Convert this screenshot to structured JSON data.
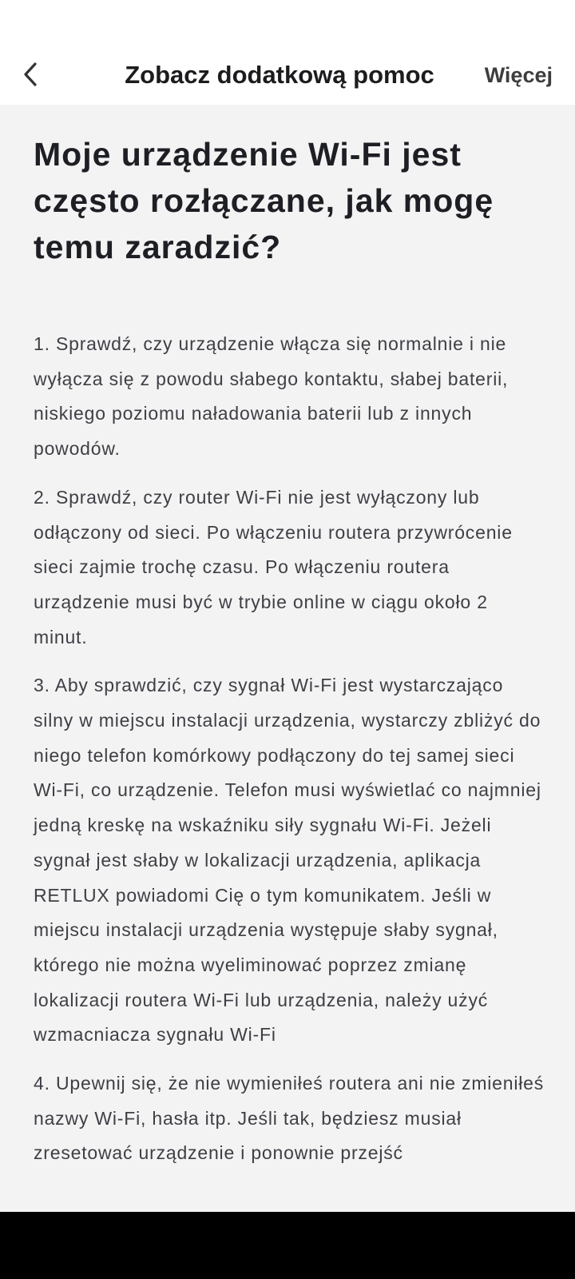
{
  "header": {
    "title": "Zobacz dodatkową pomoc",
    "more_label": "Więcej"
  },
  "article": {
    "title": "Moje urządzenie Wi-Fi jest często rozłączane, jak mogę temu zaradzić?",
    "paragraphs": [
      "1. Sprawdź, czy urządzenie włącza się normalnie i nie wyłącza się z powodu słabego kontaktu, słabej baterii, niskiego poziomu naładowania baterii lub z innych powodów.",
      "2. Sprawdź, czy router Wi-Fi nie jest wyłączony lub odłączony od sieci. Po włączeniu routera przywrócenie sieci zajmie trochę czasu. Po włączeniu routera urządzenie musi być w trybie online w ciągu około 2 minut.",
      "3. Aby sprawdzić, czy sygnał Wi-Fi jest wystarczająco silny w miejscu instalacji urządzenia, wystarczy zbliżyć do niego telefon komórkowy podłączony do tej samej sieci Wi-Fi, co urządzenie. Telefon musi wyświetlać co najmniej jedną kreskę na wskaźniku siły sygnału Wi-Fi. Jeżeli sygnał jest słaby w lokalizacji urządzenia, aplikacja RETLUX powiadomi Cię o tym komunikatem. Jeśli w miejscu instalacji urządzenia występuje słaby sygnał, którego nie można wyeliminować poprzez zmianę lokalizacji routera Wi-Fi lub urządzenia, należy użyć wzmacniacza sygnału Wi-Fi",
      "4. Upewnij się, że nie wymieniłeś routera ani nie zmieniłeś nazwy Wi-Fi, hasła itp. Jeśli tak, będziesz musiał zresetować urządzenie i ponownie przejść"
    ]
  },
  "icons": {
    "back": "chevron-left-icon"
  },
  "colors": {
    "background": "#f3f3f3",
    "header_background": "#ffffff",
    "title_text": "#1e1f24",
    "body_text": "#3e3f45",
    "nav_bar": "#000000"
  }
}
